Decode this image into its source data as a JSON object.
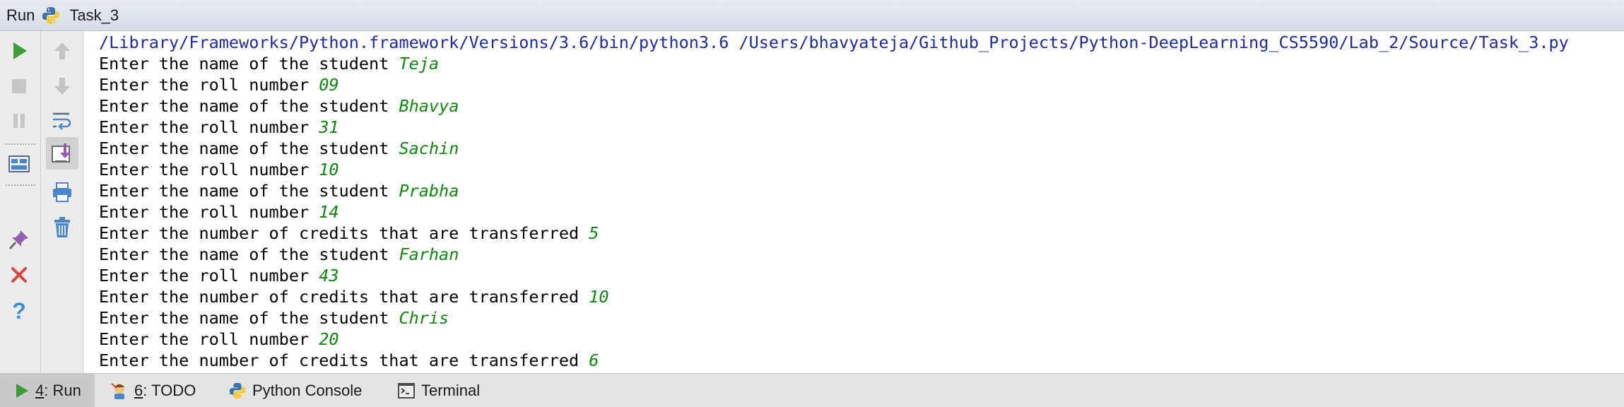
{
  "header": {
    "run_label": "Run",
    "config_name": "Task_3"
  },
  "toolbar": {
    "icons": [
      "run-icon",
      "stop-icon",
      "pause-icon",
      "layout-icon",
      "pin-icon",
      "close-icon",
      "help-icon",
      "up-arrow-icon",
      "down-arrow-icon",
      "soft-wrap-icon",
      "scroll-to-end-icon",
      "print-icon",
      "trash-icon"
    ]
  },
  "console": {
    "command": "/Library/Frameworks/Python.framework/Versions/3.6/bin/python3.6 /Users/bhavyateja/Github_Projects/Python-DeepLearning_CS5590/Lab_2/Source/Task_3.py",
    "lines": [
      {
        "prompt": "Enter the name of the student ",
        "input": "Teja"
      },
      {
        "prompt": "Enter the roll number ",
        "input": "09"
      },
      {
        "prompt": "Enter the name of the student ",
        "input": "Bhavya"
      },
      {
        "prompt": "Enter the roll number ",
        "input": "31"
      },
      {
        "prompt": "Enter the name of the student ",
        "input": "Sachin"
      },
      {
        "prompt": "Enter the roll number ",
        "input": "10"
      },
      {
        "prompt": "Enter the name of the student ",
        "input": "Prabha"
      },
      {
        "prompt": "Enter the roll number ",
        "input": "14"
      },
      {
        "prompt": "Enter the number of credits that are transferred ",
        "input": "5"
      },
      {
        "prompt": "Enter the name of the student ",
        "input": "Farhan"
      },
      {
        "prompt": "Enter the roll number ",
        "input": "43"
      },
      {
        "prompt": "Enter the number of credits that are transferred ",
        "input": "10"
      },
      {
        "prompt": "Enter the name of the student ",
        "input": "Chris"
      },
      {
        "prompt": "Enter the roll number ",
        "input": "20"
      },
      {
        "prompt": "Enter the number of credits that are transferred ",
        "input": "6"
      }
    ]
  },
  "bottom_tabs": [
    {
      "mnemonic": "4",
      "label": ": Run",
      "icon": "run-icon",
      "active": true
    },
    {
      "mnemonic": "6",
      "label": ": TODO",
      "icon": "todo-icon",
      "active": false
    },
    {
      "mnemonic": "",
      "label": "Python Console",
      "icon": "python-console-icon",
      "active": false
    },
    {
      "mnemonic": "",
      "label": "Terminal",
      "icon": "terminal-icon",
      "active": false
    }
  ],
  "colors": {
    "command_text": "#1b2aa6",
    "user_input": "#0d8a0d",
    "run_green": "#3a9d3a",
    "close_red": "#d9453b",
    "help_blue": "#3d8fd6"
  }
}
